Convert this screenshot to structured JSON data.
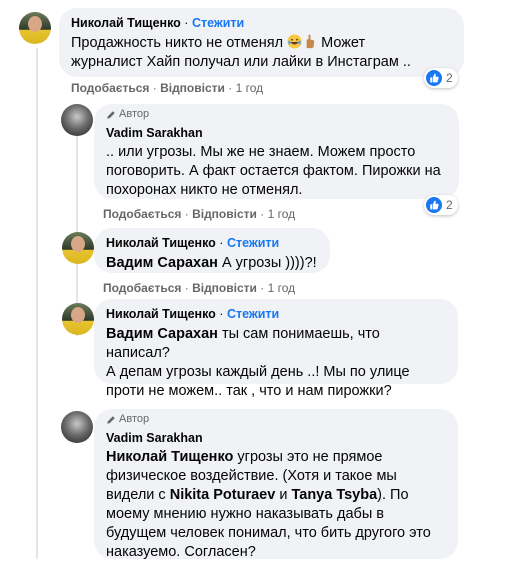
{
  "comments": [
    {
      "author": "Николай Тищенко",
      "follow": "Стежити",
      "line1": "Продажность никто не отменял",
      "line1_after": "Может",
      "line2": "журналист Хайп получал или лайки в Инстаграм ..",
      "react_count": "2",
      "like": "Подобається",
      "reply": "Відповісти",
      "time": "1 год"
    },
    {
      "badge": "Автор",
      "author": "Vadim Sarakhan",
      "lines": [
        ".. или угрозы. Мы же не знаем. Можем просто",
        "поговорить. А факт остается фактом. Пирожки на",
        "похоронах никто не отменял."
      ],
      "react_count": "2",
      "like": "Подобається",
      "reply": "Відповісти",
      "time": "1 год"
    },
    {
      "author": "Николай Тищенко",
      "follow": "Стежити",
      "mention": "Вадим Сарахан",
      "text": "А угрозы ))))?!",
      "like": "Подобається",
      "reply": "Відповісти",
      "time": "1 год"
    },
    {
      "author": "Николай Тищенко",
      "follow": "Стежити",
      "mention": "Вадим Сарахан",
      "line1": "ты сам понимаешь, что написал?",
      "line2": "А депам угрозы каждый день ..! Мы по улице",
      "line3": "проти не можем.. так , что и нам пирожки?"
    },
    {
      "badge": "Автор",
      "author": "Vadim Sarakhan",
      "mention": "Николай Тищенко",
      "line1": "угрозы это не прямое",
      "line2": "физическое воздействие. (Хотя и такое мы",
      "line3a": "видели с",
      "tag1": "Nikita Poturaev",
      "and": "и",
      "tag2": "Tanya Tsyba",
      "line3b": "). По",
      "line4": "моему мнению нужно наказывать дабы в",
      "line5": "будущем человек понимал, что бить другого это",
      "line6": "наказуемо. Согласен?"
    }
  ],
  "colors": {
    "link": "#1877f2",
    "bubble": "#f0f2f5",
    "meta": "#65676b"
  },
  "icons": [
    "avatar",
    "laughing-emoji-icon",
    "hand-emoji-icon",
    "like-reaction-icon",
    "pen-author-icon"
  ]
}
